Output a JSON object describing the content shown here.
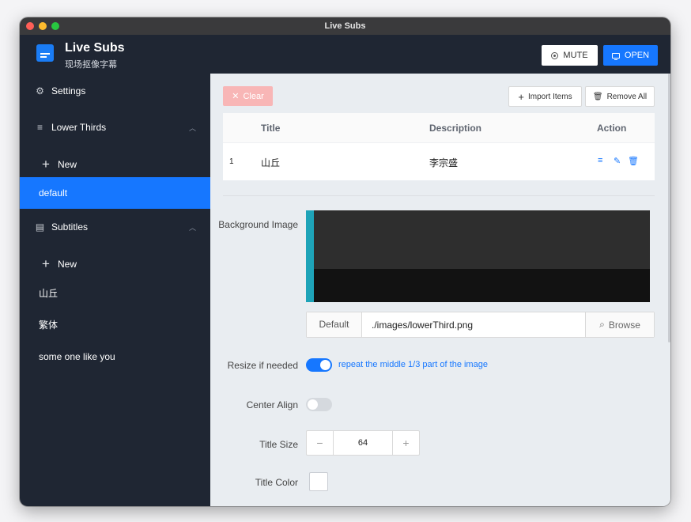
{
  "window": {
    "title": "Live Subs"
  },
  "header": {
    "app_title": "Live Subs",
    "app_subtitle": "现场抠像字幕",
    "mute_label": "MUTE",
    "open_label": "OPEN"
  },
  "sidebar": {
    "settings": "Settings",
    "lower_thirds": "Lower Thirds",
    "lower_thirds_new": "New",
    "lower_thirds_items": [
      "default"
    ],
    "subtitles": "Subtitles",
    "subtitles_new": "New",
    "subtitles_items": [
      "山丘",
      "繁体",
      "some one like you"
    ]
  },
  "toolbar": {
    "clear_label": "Clear",
    "import_label": "Import Items",
    "remove_all_label": "Remove All"
  },
  "table": {
    "columns": [
      "Title",
      "Description",
      "Action"
    ],
    "rows": [
      {
        "index": "1",
        "title": "山丘",
        "description": "李宗盛"
      }
    ]
  },
  "form": {
    "background_image_label": "Background Image",
    "image_default_label": "Default",
    "image_path": "./images/lowerThird.png",
    "browse_label": "Browse",
    "resize_label": "Resize if needed",
    "resize_on": true,
    "resize_hint": "repeat the middle 1/3 part of the image",
    "center_align_label": "Center Align",
    "center_align_on": false,
    "title_size_label": "Title Size",
    "title_size_value": "64",
    "title_color_label": "Title Color",
    "title_color_value": "#ffffff"
  },
  "colors": {
    "accent": "#1677ff",
    "sidebar_bg": "#1f2633",
    "clear_button": "#f8b6b6",
    "preview_bar": "#1ea3b8"
  }
}
